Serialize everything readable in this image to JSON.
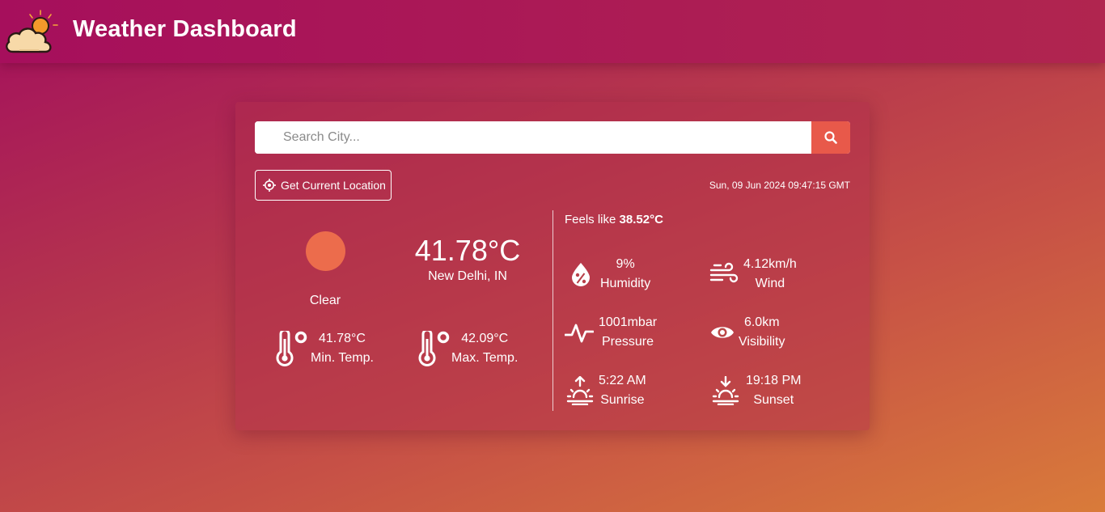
{
  "header": {
    "title": "Weather Dashboard",
    "logo_icon": "cloud-sun-icon"
  },
  "search": {
    "placeholder": "Search City...",
    "value": "",
    "pin_icon": "location-pin-icon",
    "button_icon": "search-icon"
  },
  "location_button": {
    "label": "Get Current Location",
    "icon": "crosshair-icon"
  },
  "datetime": "Sun, 09 Jun 2024 09:47:15 GMT",
  "current": {
    "condition_icon": "sun-icon",
    "condition": "Clear",
    "temperature": "41.78°C",
    "city": "New Delhi, IN",
    "min_temp": {
      "value": "41.78°C",
      "label": "Min. Temp.",
      "icon": "thermometer-icon"
    },
    "max_temp": {
      "value": "42.09°C",
      "label": "Max. Temp.",
      "icon": "thermometer-icon"
    }
  },
  "details": {
    "feels_like_label": "Feels like",
    "feels_like_value": "38.52°C",
    "humidity": {
      "value": "9%",
      "label": "Humidity",
      "icon": "humidity-drop-icon"
    },
    "wind": {
      "value": "4.12km/h",
      "label": "Wind",
      "icon": "wind-icon"
    },
    "pressure": {
      "value": "1001mbar",
      "label": "Pressure",
      "icon": "pulse-icon"
    },
    "visibility": {
      "value": "6.0km",
      "label": "Visibility",
      "icon": "eye-icon"
    },
    "sunrise": {
      "value": "5:22 AM",
      "label": "Sunrise",
      "icon": "sunrise-icon"
    },
    "sunset": {
      "value": "19:18 PM",
      "label": "Sunset",
      "icon": "sunset-icon"
    }
  },
  "colors": {
    "accent": "#e8594a",
    "sun": "#ec6c4c",
    "header": "#a60f5c"
  }
}
